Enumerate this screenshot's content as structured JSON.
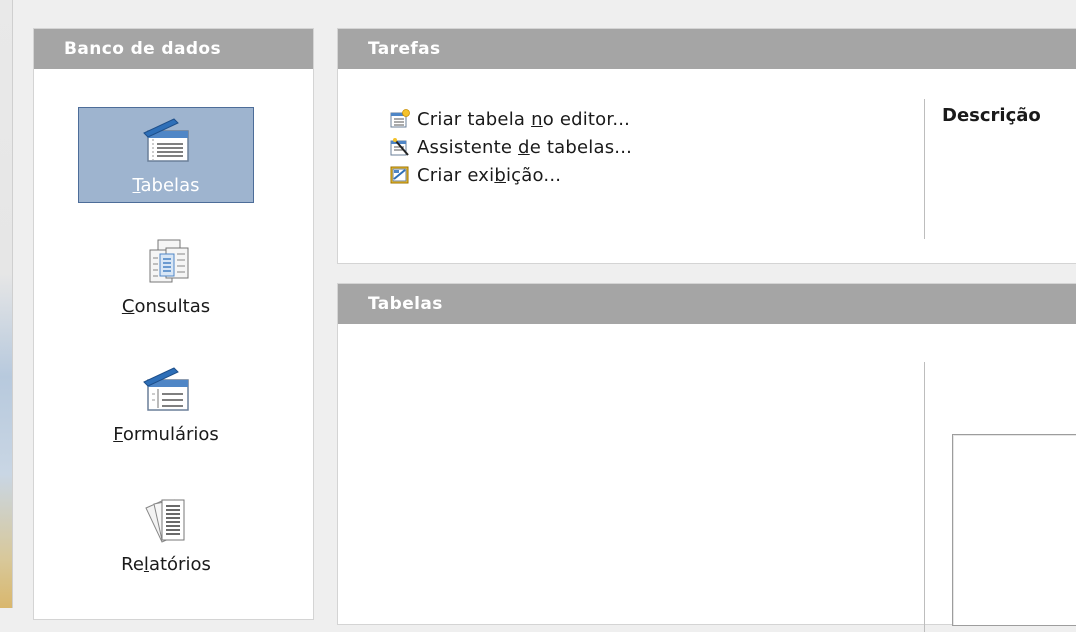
{
  "database_panel": {
    "title": "Banco de dados",
    "items": [
      {
        "id": "tabelas",
        "pre": "",
        "mnemonic": "T",
        "post": "abelas",
        "selected": true,
        "icon": "table-icon"
      },
      {
        "id": "consultas",
        "pre": "",
        "mnemonic": "C",
        "post": "onsultas",
        "selected": false,
        "icon": "query-icon"
      },
      {
        "id": "formularios",
        "pre": "",
        "mnemonic": "F",
        "post": "ormulários",
        "selected": false,
        "icon": "form-icon"
      },
      {
        "id": "relatorios",
        "pre": "Re",
        "mnemonic": "l",
        "post": "atórios",
        "selected": false,
        "icon": "report-icon"
      }
    ]
  },
  "tasks_panel": {
    "title": "Tarefas",
    "tasks": [
      {
        "pre": "Criar tabela ",
        "mnemonic": "n",
        "post": "o editor...",
        "icon": "new-table-icon"
      },
      {
        "pre": "Assistente ",
        "mnemonic": "d",
        "post": "e tabelas...",
        "icon": "table-wizard-icon"
      },
      {
        "pre": "Criar exi",
        "mnemonic": "b",
        "post": "ição...",
        "icon": "create-view-icon"
      }
    ],
    "description_label": "Descrição"
  },
  "tables_panel": {
    "title": "Tabelas"
  },
  "colors": {
    "header_bg": "#a5a5a5",
    "selection_bg": "#9eb4cf",
    "selection_border": "#4d6d99",
    "panel_bg": "#ffffff"
  }
}
